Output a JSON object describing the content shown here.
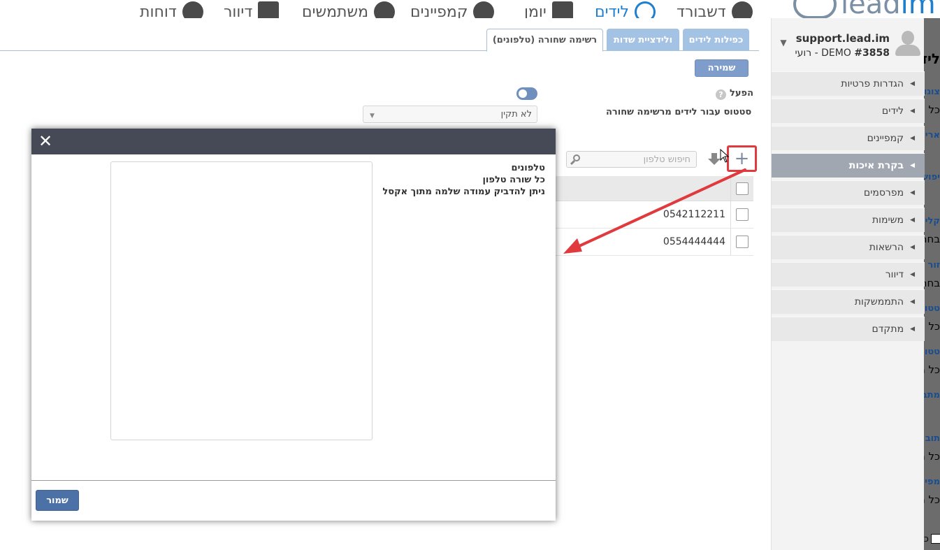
{
  "top_nav": {
    "items": [
      {
        "label": "דוחות",
        "icon": "pie-chart-icon"
      },
      {
        "label": "דיוור",
        "icon": "envelope-icon"
      },
      {
        "label": "משתמשים",
        "icon": "users-icon"
      },
      {
        "label": "קמפיינים",
        "icon": "target-icon"
      },
      {
        "label": "יומן",
        "icon": "calendar-icon"
      },
      {
        "label": "לידים",
        "icon": "globe-icon"
      },
      {
        "label": "דשבורד",
        "icon": "speedometer-icon"
      }
    ],
    "active": "לידים",
    "brand": {
      "text": "lead",
      "suffix": "im"
    }
  },
  "background_page": {
    "fragments": [
      "ליד",
      "צוגו",
      "כל ה",
      "אריך",
      "יפוש",
      "קלי",
      "בחר",
      "זור",
      "בחר",
      "טטו",
      "כל ה",
      "טטו",
      "כל ה",
      "מתב",
      "תוב",
      "כל ה",
      "מפי",
      "כל ה",
      "כ"
    ]
  },
  "user": {
    "email": "support.lead.im",
    "account_id": "#3858",
    "account_name": "רועי - DEMO"
  },
  "settings_menu": {
    "items": [
      {
        "label": "הגדרות פרטיות"
      },
      {
        "label": "לידים"
      },
      {
        "label": "קמפיינים"
      },
      {
        "label": "בקרת איכות",
        "active": true
      },
      {
        "label": "מפרסמים"
      },
      {
        "label": "משימות"
      },
      {
        "label": "הרשאות"
      },
      {
        "label": "דיוור"
      },
      {
        "label": "התממשקות"
      },
      {
        "label": "מתקדם"
      }
    ]
  },
  "tabs": {
    "items": [
      {
        "label": "כפילות לידים"
      },
      {
        "label": "ולידציית שדות"
      },
      {
        "label": "רשימה שחורה (טלפונים)",
        "active": true
      }
    ]
  },
  "form": {
    "save_label": "שמירה",
    "help_symbol": "?",
    "enable_label": "הפעל",
    "enabled": true,
    "status_label": "סטטוס עבור לידים מרשימה שחורה",
    "status_value": "לא תקין"
  },
  "toolbar": {
    "add_symbol": "+",
    "search_placeholder": "חיפוש טלפון"
  },
  "table": {
    "rows": [
      {
        "phone": "0542112211"
      },
      {
        "phone": "0554444444"
      }
    ]
  },
  "modal": {
    "close_symbol": "✕",
    "label_title": "טלפונים",
    "label_line1": "כל שורה טלפון",
    "label_line2": "ניתן להדביק עמודה שלמה מתוך אקסל",
    "textarea_value": "",
    "save_label": "שמור"
  },
  "colors": {
    "accent": "#7f9dcb",
    "modal_header": "#454a56",
    "menu_active": "#a1a7b1",
    "highlight_red": "#e0393e"
  }
}
